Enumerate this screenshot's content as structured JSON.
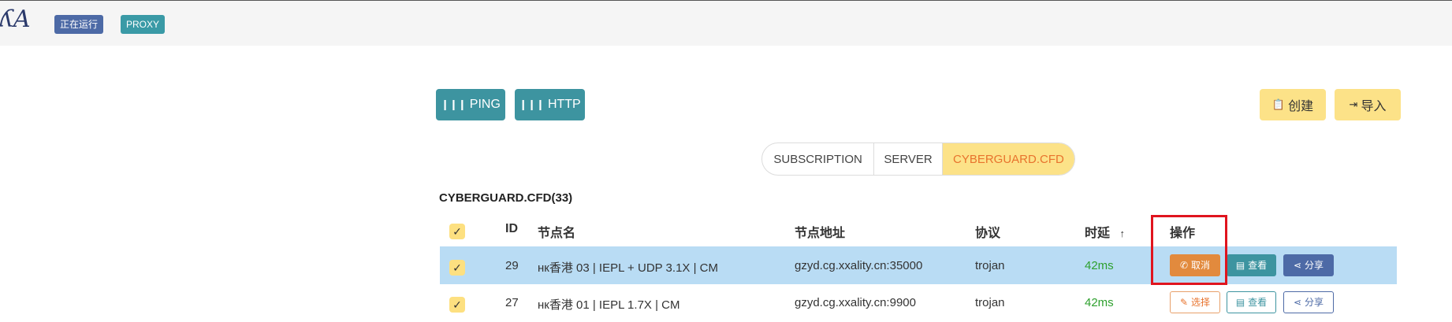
{
  "topbar": {
    "logo": "ʎA",
    "status_tag": "正在运行",
    "mode_tag": "PROXY"
  },
  "toolbar": {
    "ping_label": "PING",
    "http_label": "HTTP",
    "create_label": "创建",
    "import_label": "导入"
  },
  "tabs": [
    {
      "label": "SUBSCRIPTION",
      "active": false
    },
    {
      "label": "SERVER",
      "active": false
    },
    {
      "label": "CYBERGUARD.CFD",
      "active": true
    }
  ],
  "section_title": "CYBERGUARD.CFD(33)",
  "table": {
    "headers": {
      "id": "ID",
      "name": "节点名",
      "address": "节点地址",
      "protocol": "协议",
      "latency": "时延",
      "sort_indicator": "↑",
      "actions": "操作"
    },
    "rows": [
      {
        "id": "29",
        "name": "нк香港 03 | IEPL + UDP 3.1X | CM",
        "address": "gzyd.cg.xxality.cn:35000",
        "protocol": "trojan",
        "latency": "42ms",
        "selected": true,
        "primary_action": "取消",
        "view_action": "查看",
        "share_action": "分享"
      },
      {
        "id": "27",
        "name": "нк香港 01 | IEPL 1.7X | CM",
        "address": "gzyd.cg.xxality.cn:9900",
        "protocol": "trojan",
        "latency": "42ms",
        "selected": false,
        "primary_action": "选择",
        "view_action": "查看",
        "share_action": "分享"
      }
    ]
  },
  "colors": {
    "teal": "#3d94a0",
    "yellow": "#fce288",
    "orange": "#e28a3d",
    "indigo": "#4d6aa6",
    "selected_row": "#b9dcf4",
    "latency_green": "#2ea02e",
    "highlight_red": "#e0141e"
  }
}
